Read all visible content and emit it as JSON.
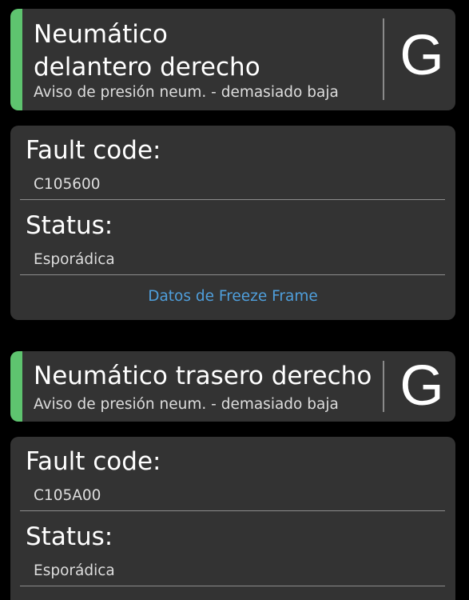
{
  "colors": {
    "background": "#000000",
    "card": "#333333",
    "accent_green": "#5ec46f",
    "link_blue": "#4f9fdc"
  },
  "entries": [
    {
      "title": "Neumático\ndelantero derecho",
      "subtitle": "Aviso de presión neum. - demasiado baja",
      "grade": "G",
      "fault_code_label": "Fault code:",
      "fault_code": "C105600",
      "status_label": "Status:",
      "status": "Esporádica",
      "freeze_frame_link": "Datos de Freeze Frame"
    },
    {
      "title": "Neumático trasero derecho",
      "subtitle": "Aviso de presión neum. - demasiado baja",
      "grade": "G",
      "fault_code_label": "Fault code:",
      "fault_code": "C105A00",
      "status_label": "Status:",
      "status": "Esporádica"
    }
  ]
}
